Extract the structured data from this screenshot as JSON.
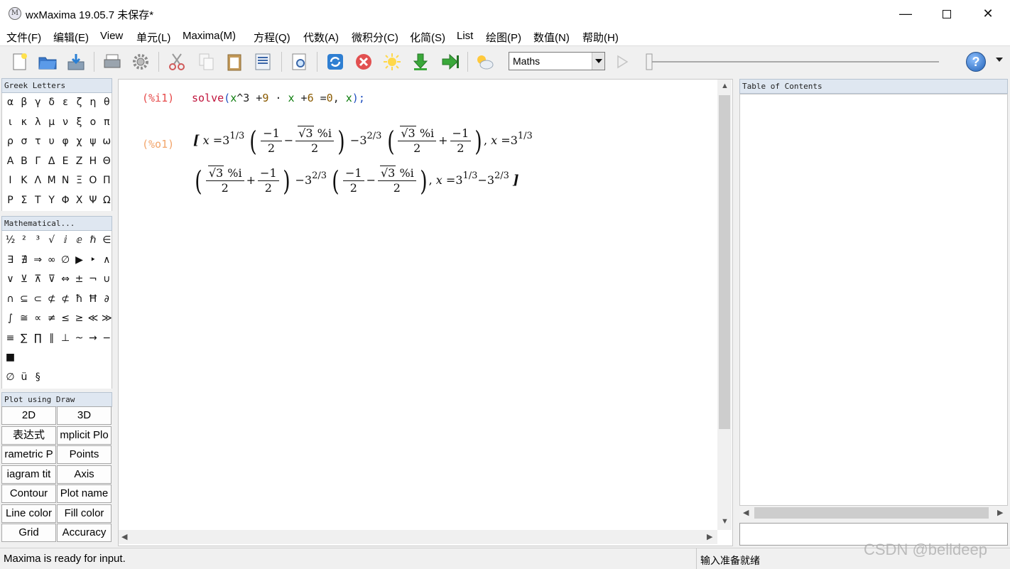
{
  "window": {
    "title": "wxMaxima 19.05.7 未保存*",
    "minimize": "—",
    "close": "✕"
  },
  "menu": [
    "文件(F)",
    "编辑(E)",
    "View",
    "单元(L)",
    "Maxima(M)",
    "方程(Q)",
    "代数(A)",
    "微积分(C)",
    "化简(S)",
    "List",
    "绘图(P)",
    "数值(N)",
    "帮助(H)"
  ],
  "toolbar": {
    "icons": [
      "new-file-icon",
      "open-folder-icon",
      "save-icon",
      "print-icon",
      "settings-gear-icon",
      "cut-icon",
      "copy-icon",
      "paste-icon",
      "select-all-icon",
      "find-icon",
      "restart-icon",
      "interrupt-icon",
      "follow-icon",
      "evaluate-icon",
      "evaluate-all-icon",
      "weather-icon",
      "play-icon",
      "help-icon"
    ],
    "style_select": "Maths",
    "help": "?"
  },
  "greek": {
    "title": "Greek Letters",
    "rows": [
      [
        "α",
        "β",
        "γ",
        "δ",
        "ε",
        "ζ",
        "η",
        "θ"
      ],
      [
        "ι",
        "κ",
        "λ",
        "μ",
        "ν",
        "ξ",
        "ο",
        "π"
      ],
      [
        "ρ",
        "σ",
        "τ",
        "υ",
        "φ",
        "χ",
        "ψ",
        "ω"
      ],
      [
        "Α",
        "Β",
        "Γ",
        "Δ",
        "Ε",
        "Ζ",
        "Η",
        "Θ"
      ],
      [
        "Ι",
        "Κ",
        "Λ",
        "Μ",
        "Ν",
        "Ξ",
        "Ο",
        "Π"
      ],
      [
        "Ρ",
        "Σ",
        "Τ",
        "Υ",
        "Φ",
        "Χ",
        "Ψ",
        "Ω"
      ]
    ]
  },
  "mathsym": {
    "title": "Mathematical...",
    "rows": [
      [
        "½",
        "²",
        "³",
        "√",
        "ⅈ",
        "ⅇ",
        "ℏ",
        "∈"
      ],
      [
        "∃",
        "∄",
        "⇒",
        "∞",
        "∅",
        "▶",
        "‣",
        "∧"
      ],
      [
        "∨",
        "⊻",
        "⊼",
        "⊽",
        "⇔",
        "±",
        "¬",
        "∪"
      ],
      [
        "∩",
        "⊆",
        "⊂",
        "⊄",
        "⊄",
        "ħ",
        "Ħ",
        "∂"
      ],
      [
        "∫",
        "≅",
        "∝",
        "≠",
        "≤",
        "≥",
        "≪",
        "≫"
      ],
      [
        "≡",
        "∑",
        "∏",
        "∥",
        "⊥",
        "~",
        "→",
        "−"
      ],
      [
        "■"
      ],
      [
        "∅",
        "ü",
        "§"
      ]
    ]
  },
  "draw": {
    "title": "Plot using Draw",
    "buttons": [
      "2D",
      "3D",
      "表达式",
      "mplicit Plo",
      "rametric P",
      "Points",
      "iagram tit",
      "Axis",
      "Contour",
      "Plot name",
      "Line color",
      "Fill color",
      "Grid",
      "Accuracy"
    ]
  },
  "worksheet": {
    "input_label": "(%i1)",
    "output_label": "(%o1)",
    "code": {
      "fn": "solve",
      "open": "(",
      "x": "x",
      "pow": "^3",
      "plus": " +",
      "nine": "9",
      "dot": "·",
      "x2": "x",
      "six": "6",
      "eq": "=",
      "zero": "0",
      "comma": ",",
      "var": "x",
      "close": ")",
      "semi": ";"
    },
    "output": {
      "open": "[",
      "close": "]",
      "x": "x",
      "eq": "=",
      "three": "3",
      "e13": "1/3",
      "e23": "2/3",
      "minus1": "−1",
      "two": "2",
      "sqrt3": "√3",
      "pct_i": "%i",
      "minus": "−",
      "plus": "+",
      "comma": ","
    }
  },
  "toc": {
    "title": "Table of Contents"
  },
  "status": {
    "left": "Maxima is ready for input.",
    "right": "输入准备就绪"
  },
  "watermark": "CSDN @belldeep"
}
